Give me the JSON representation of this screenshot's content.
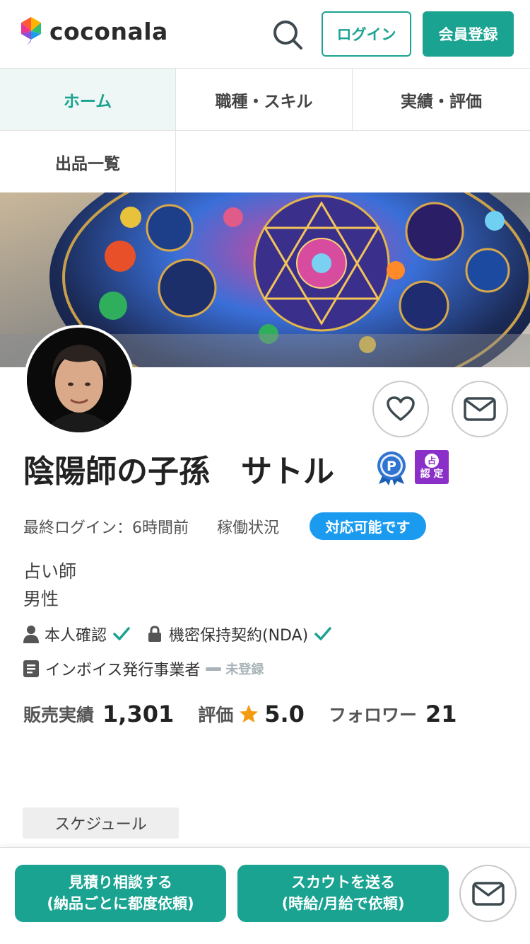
{
  "header": {
    "logo_text": "coconala",
    "login_label": "ログイン",
    "signup_label": "会員登録"
  },
  "tabs": [
    {
      "label": "ホーム",
      "active": true
    },
    {
      "label": "職種・スキル",
      "active": false
    },
    {
      "label": "実績・評価",
      "active": false
    },
    {
      "label": "出品一覧",
      "active": false
    }
  ],
  "profile": {
    "name": "陰陽師の子孫　サトル",
    "badge_certified_top": "占",
    "badge_certified_bottom": "認 定",
    "last_login_label": "最終ログイン：",
    "last_login_value": "6時間前",
    "work_status_label": "稼働状況",
    "work_status_value": "対応可能です",
    "occupation": "占い師",
    "gender": "男性",
    "identity_verified_label": "本人確認",
    "nda_label": "機密保持契約(NDA)",
    "invoice_label": "インボイス発行事業者",
    "invoice_status": "未登録"
  },
  "stats": {
    "sales_label": "販売実績",
    "sales_value": "1,301",
    "rating_label": "評価",
    "rating_value": "5.0",
    "followers_label": "フォロワー",
    "followers_value": "21"
  },
  "schedule_tab_label": "スケジュール",
  "footer": {
    "estimate_line1": "見積り相談する",
    "estimate_line2": "(納品ごとに都度依頼)",
    "scout_line1": "スカウトを送る",
    "scout_line2": "(時給/月給で依頼)"
  },
  "colors": {
    "accent": "#1aa391",
    "status_blue": "#1a9bf0",
    "certified_purple": "#8b2fc9",
    "star": "#f39c12"
  }
}
